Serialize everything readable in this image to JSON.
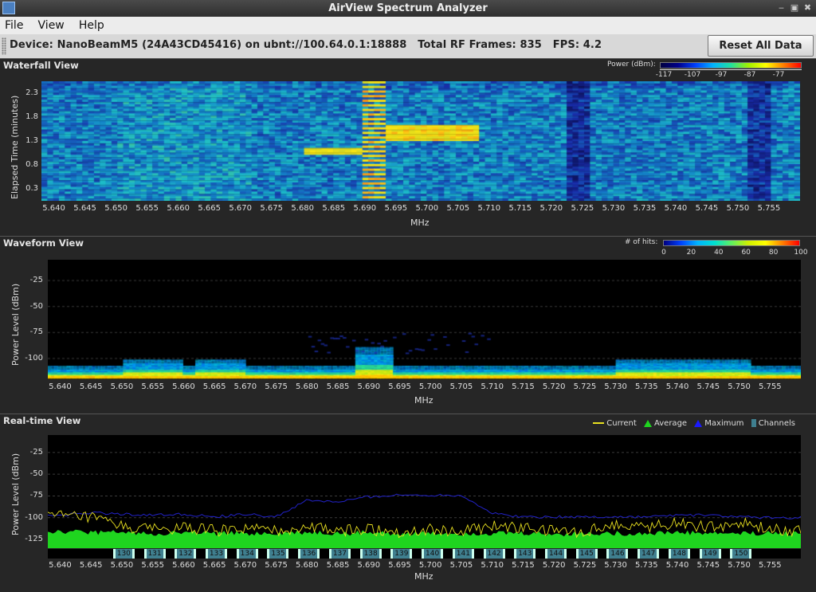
{
  "window": {
    "title": "AirView Spectrum Analyzer",
    "min": "‒",
    "max": "▣",
    "close": "✖"
  },
  "menu": [
    {
      "label": "File"
    },
    {
      "label": "View"
    },
    {
      "label": "Help"
    }
  ],
  "device": {
    "info": "Device: NanoBeamM5 (24A43CD45416) on ubnt://100.64.0.1:18888   Total RF Frames: 835   FPS: 4.2"
  },
  "toolbar": {
    "reset_label": "Reset All Data"
  },
  "freq_ticks": [
    "5.640",
    "5.645",
    "5.650",
    "5.655",
    "5.660",
    "5.665",
    "5.670",
    "5.675",
    "5.680",
    "5.685",
    "5.690",
    "5.695",
    "5.700",
    "5.705",
    "5.710",
    "5.715",
    "5.720",
    "5.725",
    "5.730",
    "5.735",
    "5.740",
    "5.745",
    "5.750",
    "5.755"
  ],
  "waterfall": {
    "title": "Waterfall View",
    "xlabel": "MHz",
    "ylabel": "Elapsed Time (minutes)",
    "yticks": [
      "2.3",
      "1.8",
      "1.3",
      "0.8",
      "0.3"
    ],
    "legend_label": "Power (dBm):",
    "legend_ticks": [
      "-117",
      "-107",
      "-97",
      "-87",
      "-77"
    ]
  },
  "waveform": {
    "title": "Waveform View",
    "xlabel": "MHz",
    "ylabel": "Power Level (dBm)",
    "yticks": [
      "-25",
      "-50",
      "-75",
      "-100"
    ],
    "legend_label": "# of hits:",
    "legend_ticks": [
      "0",
      "20",
      "40",
      "60",
      "80",
      "100"
    ]
  },
  "realtime": {
    "title": "Real-time View",
    "xlabel": "MHz",
    "ylabel": "Power Level (dBm)",
    "yticks": [
      "-25",
      "-50",
      "-75",
      "-100",
      "-125"
    ],
    "legend": {
      "current": "Current",
      "average": "Average",
      "maximum": "Maximum",
      "channels": "Channels"
    },
    "channels": [
      "130",
      "131",
      "132",
      "133",
      "134",
      "135",
      "136",
      "137",
      "138",
      "139",
      "140",
      "141",
      "142",
      "143",
      "144",
      "145",
      "146",
      "147",
      "148",
      "149",
      "150"
    ]
  },
  "colors": {
    "current": "#e8e020",
    "average": "#1fd51f",
    "maximum": "#1a1aa8",
    "channel": "#3f7f8f",
    "grid": "#3a3a3a"
  },
  "chart_data": [
    {
      "type": "heatmap",
      "title": "Waterfall View",
      "xlabel": "MHz",
      "ylabel": "Elapsed Time (minutes)",
      "x_range": [
        5.638,
        5.76
      ],
      "y_ticks": [
        2.3,
        1.8,
        1.3,
        0.8,
        0.3
      ],
      "colorbar": {
        "label": "Power (dBm):",
        "ticks": [
          -117,
          -107,
          -97,
          -87,
          -77
        ]
      }
    },
    {
      "type": "heatmap",
      "title": "Waveform View",
      "xlabel": "MHz",
      "ylabel": "Power Level (dBm)",
      "x_range": [
        5.638,
        5.76
      ],
      "ylim": [
        -120,
        -5
      ],
      "y_ticks": [
        -25,
        -50,
        -75,
        -100
      ],
      "colorbar": {
        "label": "# of hits:",
        "ticks": [
          0,
          20,
          40,
          60,
          80,
          100
        ]
      }
    },
    {
      "type": "line",
      "title": "Real-time View",
      "xlabel": "MHz",
      "ylabel": "Power Level (dBm)",
      "x_range": [
        5.638,
        5.76
      ],
      "ylim": [
        -135,
        -5
      ],
      "y_ticks": [
        -25,
        -50,
        -75,
        -100,
        -125
      ],
      "x": [
        5.64,
        5.645,
        5.65,
        5.655,
        5.66,
        5.665,
        5.67,
        5.675,
        5.68,
        5.685,
        5.69,
        5.695,
        5.7,
        5.705,
        5.71,
        5.715,
        5.72,
        5.725,
        5.73,
        5.735,
        5.74,
        5.745,
        5.75,
        5.755
      ],
      "series": [
        {
          "name": "Maximum",
          "values": [
            -97,
            -94,
            -96,
            -97,
            -96,
            -99,
            -96,
            -99,
            -80,
            -82,
            -76,
            -74,
            -74,
            -74,
            -95,
            -99,
            -99,
            -99,
            -99,
            -99,
            -97,
            -97,
            -99,
            -100
          ]
        },
        {
          "name": "Current",
          "values": [
            -98,
            -100,
            -110,
            -114,
            -112,
            -115,
            -113,
            -116,
            -110,
            -115,
            -113,
            -116,
            -114,
            -116,
            -110,
            -112,
            -115,
            -116,
            -107,
            -110,
            -105,
            -112,
            -106,
            -114
          ]
        },
        {
          "name": "Average",
          "values": [
            -116,
            -117,
            -117,
            -118,
            -117,
            -118,
            -118,
            -118,
            -117,
            -118,
            -117,
            -118,
            -118,
            -118,
            -118,
            -118,
            -119,
            -118,
            -118,
            -118,
            -117,
            -118,
            -118,
            -118
          ]
        }
      ]
    }
  ]
}
